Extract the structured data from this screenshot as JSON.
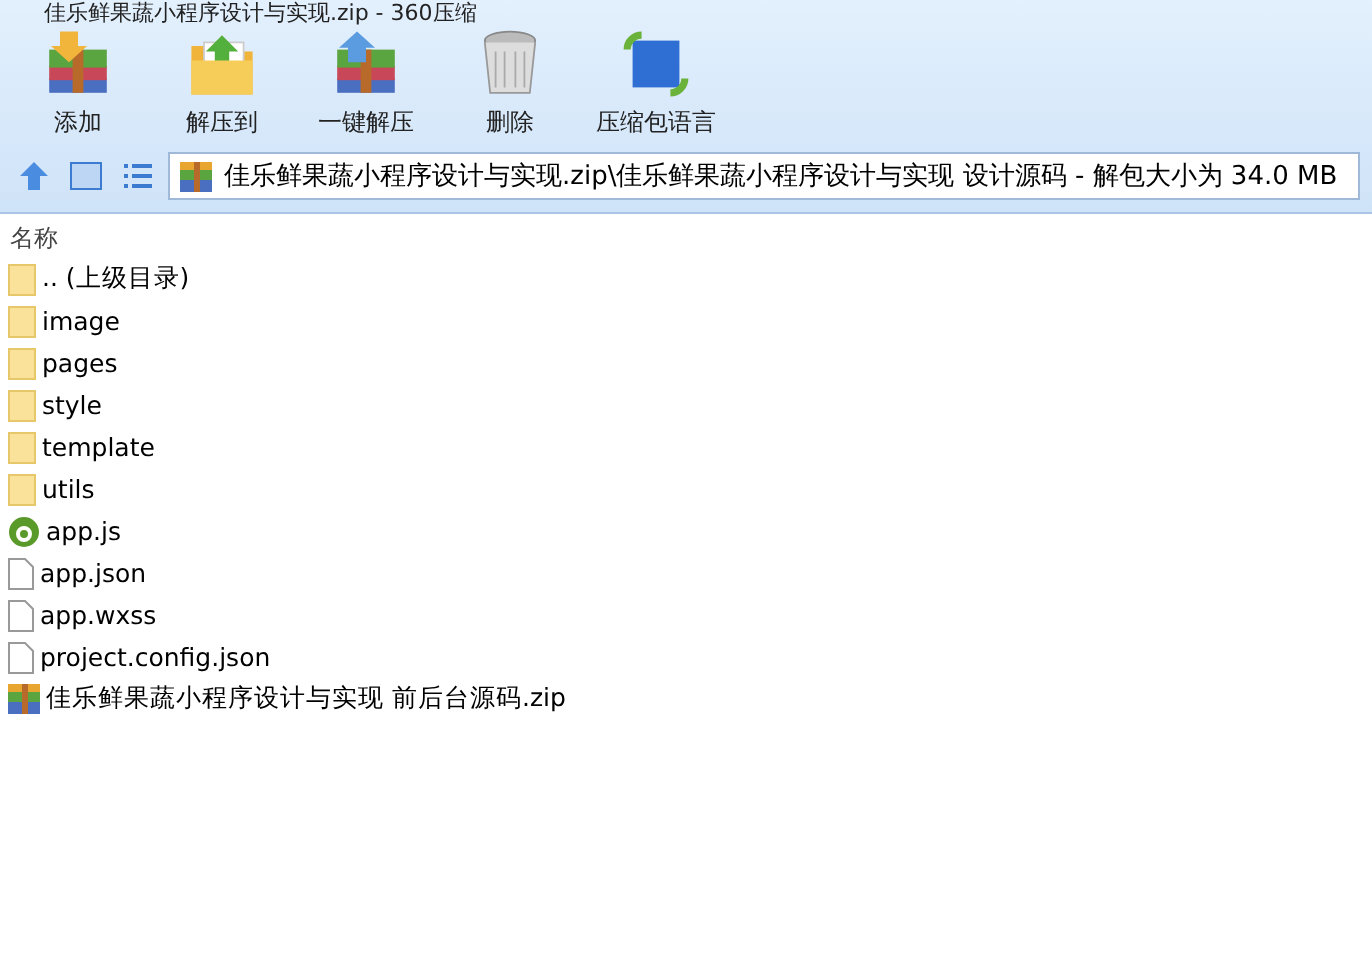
{
  "window": {
    "title": "佳乐鲜果蔬小程序设计与实现.zip - 360压缩"
  },
  "toolbar": [
    {
      "label": "添加",
      "kind": "add"
    },
    {
      "label": "解压到",
      "kind": "extract"
    },
    {
      "label": "一键解压",
      "kind": "oneclick"
    },
    {
      "label": "删除",
      "kind": "delete"
    },
    {
      "label": "压缩包语言",
      "kind": "language"
    }
  ],
  "address": {
    "value": "佳乐鲜果蔬小程序设计与实现.zip\\佳乐鲜果蔬小程序设计与实现 设计源码 - 解包大小为 34.0 MB"
  },
  "table": {
    "columns": [
      "名称"
    ],
    "rows": [
      {
        "name": ".. (上级目录)",
        "kind": "folder"
      },
      {
        "name": "image",
        "kind": "folder"
      },
      {
        "name": "pages",
        "kind": "folder"
      },
      {
        "name": "style",
        "kind": "folder"
      },
      {
        "name": "template",
        "kind": "folder"
      },
      {
        "name": "utils",
        "kind": "folder"
      },
      {
        "name": "app.js",
        "kind": "script"
      },
      {
        "name": "app.json",
        "kind": "file"
      },
      {
        "name": "app.wxss",
        "kind": "file"
      },
      {
        "name": "project.config.json",
        "kind": "file"
      },
      {
        "name": "佳乐鲜果蔬小程序设计与实现 前后台源码.zip",
        "kind": "archive"
      }
    ]
  }
}
